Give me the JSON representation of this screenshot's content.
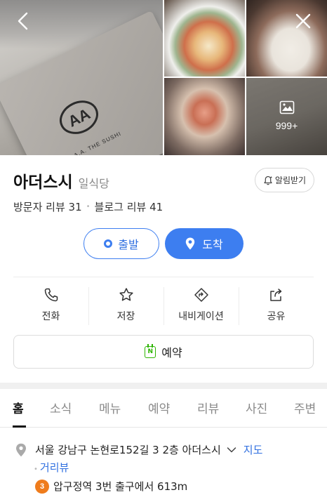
{
  "photos": {
    "logo_text": "A.A. THE SUSHI",
    "more_count": "999+"
  },
  "place": {
    "name": "아더스시",
    "category": "일식당",
    "alarm_label": "알림받기",
    "visitor_reviews": "방문자 리뷰 31",
    "blog_reviews": "블로그 리뷰 41"
  },
  "route": {
    "depart_label": "출발",
    "arrive_label": "도착"
  },
  "actions": {
    "call": "전화",
    "save": "저장",
    "navigate": "내비게이션",
    "share": "공유"
  },
  "reserve_label": "예약",
  "tabs": [
    "홈",
    "소식",
    "메뉴",
    "예약",
    "리뷰",
    "사진",
    "주변"
  ],
  "info": {
    "address": "서울 강남구 논현로152길 3 2층 아더스시",
    "map_link": "지도",
    "street_view": "거리뷰",
    "subway_line": "3",
    "subway_text": "압구정역 3번 출구에서 613m"
  },
  "colors": {
    "accent": "#3d7ef0",
    "naver_green": "#2db400",
    "line3": "#ef7c1c"
  }
}
